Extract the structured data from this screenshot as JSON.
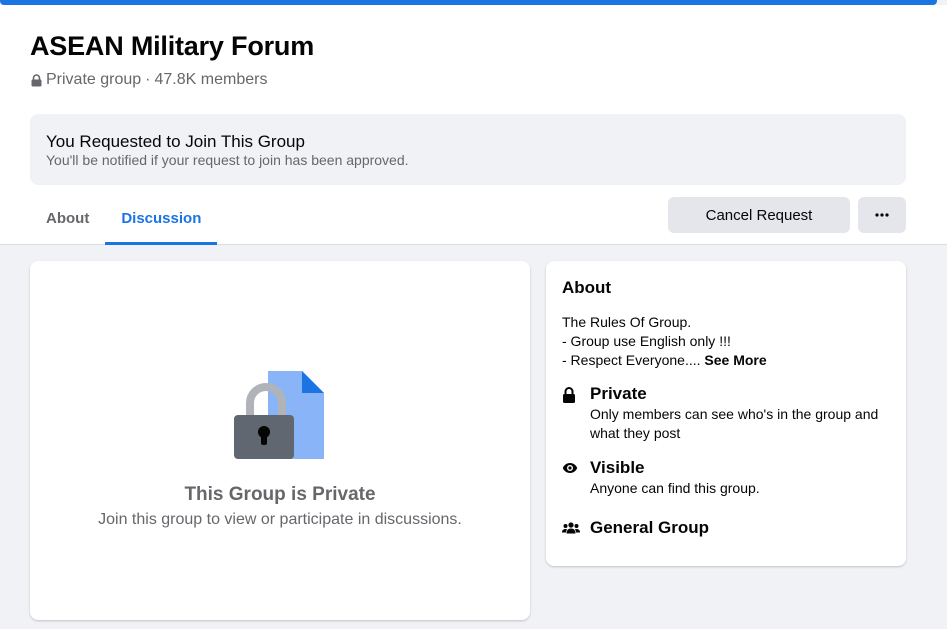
{
  "group": {
    "title": "ASEAN Military Forum",
    "privacy": "Private group",
    "separator": "·",
    "members": "47.8K members"
  },
  "banner": {
    "title": "You Requested to Join This Group",
    "subtitle": "You'll be notified if your request to join has been approved."
  },
  "tabs": [
    {
      "label": "About",
      "active": false
    },
    {
      "label": "Discussion",
      "active": true
    }
  ],
  "actions": {
    "cancel_label": "Cancel Request",
    "more_icon": "more-dots-icon"
  },
  "private_panel": {
    "title": "This Group is Private",
    "subtitle": "Join this group to view or participate in discussions.",
    "illustration": "locked-document-icon"
  },
  "about": {
    "heading": "About",
    "description_lines": [
      "The Rules Of Group.",
      "- Group use English only !!!",
      "- Respect Everyone...."
    ],
    "see_more": "See More",
    "items": [
      {
        "icon": "lock-icon",
        "title": "Private",
        "subtitle": "Only members can see who's in the group and what they post"
      },
      {
        "icon": "eye-icon",
        "title": "Visible",
        "subtitle": "Anyone can find this group."
      },
      {
        "icon": "group-people-icon",
        "title": "General Group",
        "subtitle": ""
      }
    ]
  },
  "colors": {
    "accent": "#1b74e4",
    "page_bg": "#f0f2f5",
    "button_bg": "#e4e6eb",
    "secondary_text": "#65676b"
  }
}
